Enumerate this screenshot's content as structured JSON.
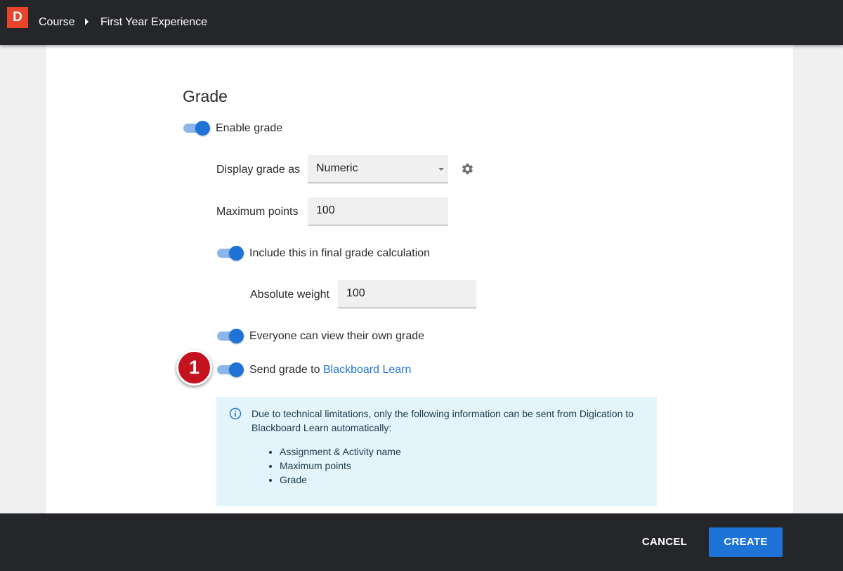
{
  "app": {
    "logo_letter": "D"
  },
  "breadcrumb": {
    "items": [
      "Course",
      "First Year Experience"
    ]
  },
  "grade": {
    "title": "Grade",
    "enable_grade": {
      "label": "Enable grade",
      "on": true
    },
    "display_grade_as": {
      "label": "Display grade as",
      "value": "Numeric"
    },
    "maximum_points": {
      "label": "Maximum points",
      "value": "100"
    },
    "include_final": {
      "label": "Include this in final grade calculation",
      "on": true
    },
    "absolute_weight": {
      "label": "Absolute weight",
      "value": "100"
    },
    "everyone_view": {
      "label": "Everyone can view their own grade",
      "on": true
    },
    "send_grade": {
      "label": "Send grade to",
      "link": "Blackboard Learn",
      "on": true
    }
  },
  "annotation": {
    "number": "1"
  },
  "info_box": {
    "text": "Due to technical limitations, only the following information can be sent from Digication to Blackboard Learn automatically:",
    "items": [
      "Assignment & Activity name",
      "Maximum points",
      "Grade"
    ]
  },
  "footer": {
    "cancel_label": "CANCEL",
    "create_label": "CREATE"
  },
  "colors": {
    "accent": "#1f73d6",
    "toggle_track": "#8ab6ea",
    "logo": "#e8442c",
    "topbar": "#252629",
    "info_bg": "#e3f4fb",
    "badge": "#c5121f"
  },
  "icons": {
    "settings": "gear-icon",
    "info": "info-icon"
  }
}
